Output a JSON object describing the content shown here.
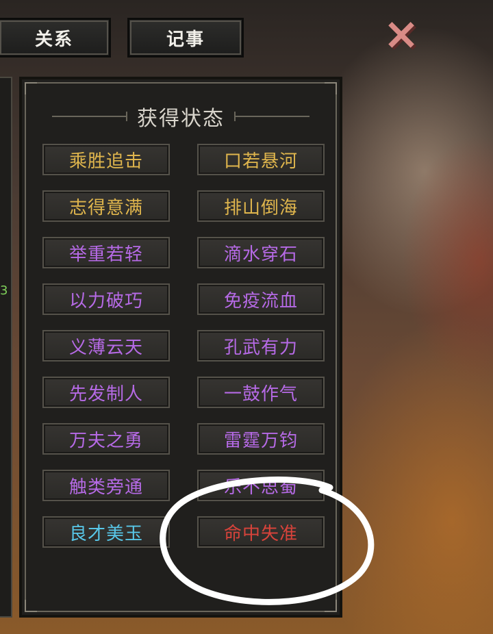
{
  "tabs": [
    {
      "label": "关系"
    },
    {
      "label": "记事"
    }
  ],
  "close_icon": "×",
  "side_value": "3",
  "panel": {
    "title": "获得状态",
    "statuses": [
      {
        "label": "乘胜追击",
        "color": "gold"
      },
      {
        "label": "口若悬河",
        "color": "gold"
      },
      {
        "label": "志得意满",
        "color": "gold"
      },
      {
        "label": "排山倒海",
        "color": "gold"
      },
      {
        "label": "举重若轻",
        "color": "purple"
      },
      {
        "label": "滴水穿石",
        "color": "purple"
      },
      {
        "label": "以力破巧",
        "color": "purple"
      },
      {
        "label": "免疫流血",
        "color": "purple"
      },
      {
        "label": "义薄云天",
        "color": "purple"
      },
      {
        "label": "孔武有力",
        "color": "purple"
      },
      {
        "label": "先发制人",
        "color": "purple"
      },
      {
        "label": "一鼓作气",
        "color": "purple"
      },
      {
        "label": "万夫之勇",
        "color": "purple"
      },
      {
        "label": "雷霆万钧",
        "color": "purple"
      },
      {
        "label": "触类旁通",
        "color": "purple"
      },
      {
        "label": "乐不思蜀",
        "color": "purple"
      },
      {
        "label": "良才美玉",
        "color": "cyan"
      },
      {
        "label": "命中失准",
        "color": "red"
      }
    ]
  },
  "colors": {
    "gold": "#e0b64d",
    "purple": "#b66ae6",
    "cyan": "#58c7e8",
    "red": "#d8433b"
  }
}
